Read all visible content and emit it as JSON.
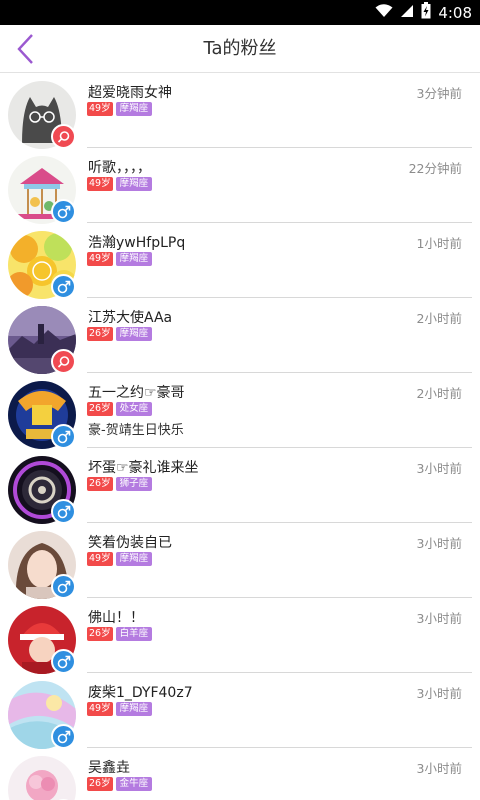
{
  "status_bar": {
    "time": "4:08"
  },
  "header": {
    "title": "Ta的粉丝"
  },
  "fans": [
    {
      "name": "超爱晓雨女神",
      "time": "3分钟前",
      "age": "49岁",
      "zodiac": "摩羯座",
      "gender": "female",
      "signature": ""
    },
    {
      "name": "听歌，，，，",
      "time": "22分钟前",
      "age": "49岁",
      "zodiac": "摩羯座",
      "gender": "male",
      "signature": ""
    },
    {
      "name": "浩瀚ywHfpLPq",
      "time": "1小时前",
      "age": "49岁",
      "zodiac": "摩羯座",
      "gender": "male",
      "signature": ""
    },
    {
      "name": "江苏大使AAa",
      "time": "2小时前",
      "age": "26岁",
      "zodiac": "摩羯座",
      "gender": "female",
      "signature": ""
    },
    {
      "name": "五一之约☞豪哥",
      "time": "2小时前",
      "age": "26岁",
      "zodiac": "处女座",
      "gender": "male",
      "signature": "豪-贺靖生日快乐"
    },
    {
      "name": "坏蛋☞豪礼谁来坐",
      "time": "3小时前",
      "age": "26岁",
      "zodiac": "狮子座",
      "gender": "male",
      "signature": ""
    },
    {
      "name": "笑着伪装自已",
      "time": "3小时前",
      "age": "49岁",
      "zodiac": "摩羯座",
      "gender": "male",
      "signature": ""
    },
    {
      "name": "佛山！！",
      "time": "3小时前",
      "age": "26岁",
      "zodiac": "白羊座",
      "gender": "male",
      "signature": ""
    },
    {
      "name": "废柴1_DYF40z7",
      "time": "3小时前",
      "age": "49岁",
      "zodiac": "摩羯座",
      "gender": "male",
      "signature": ""
    },
    {
      "name": "吴鑫垚",
      "time": "3小时前",
      "age": "26岁",
      "zodiac": "金牛座",
      "gender": "male",
      "signature": ""
    }
  ],
  "colors": {
    "accent": "#9b59d0",
    "male": "#2f8fe0",
    "female": "#f04a52",
    "age_tag": "#f24a4a",
    "zodiac_tag": "#b47be0"
  }
}
